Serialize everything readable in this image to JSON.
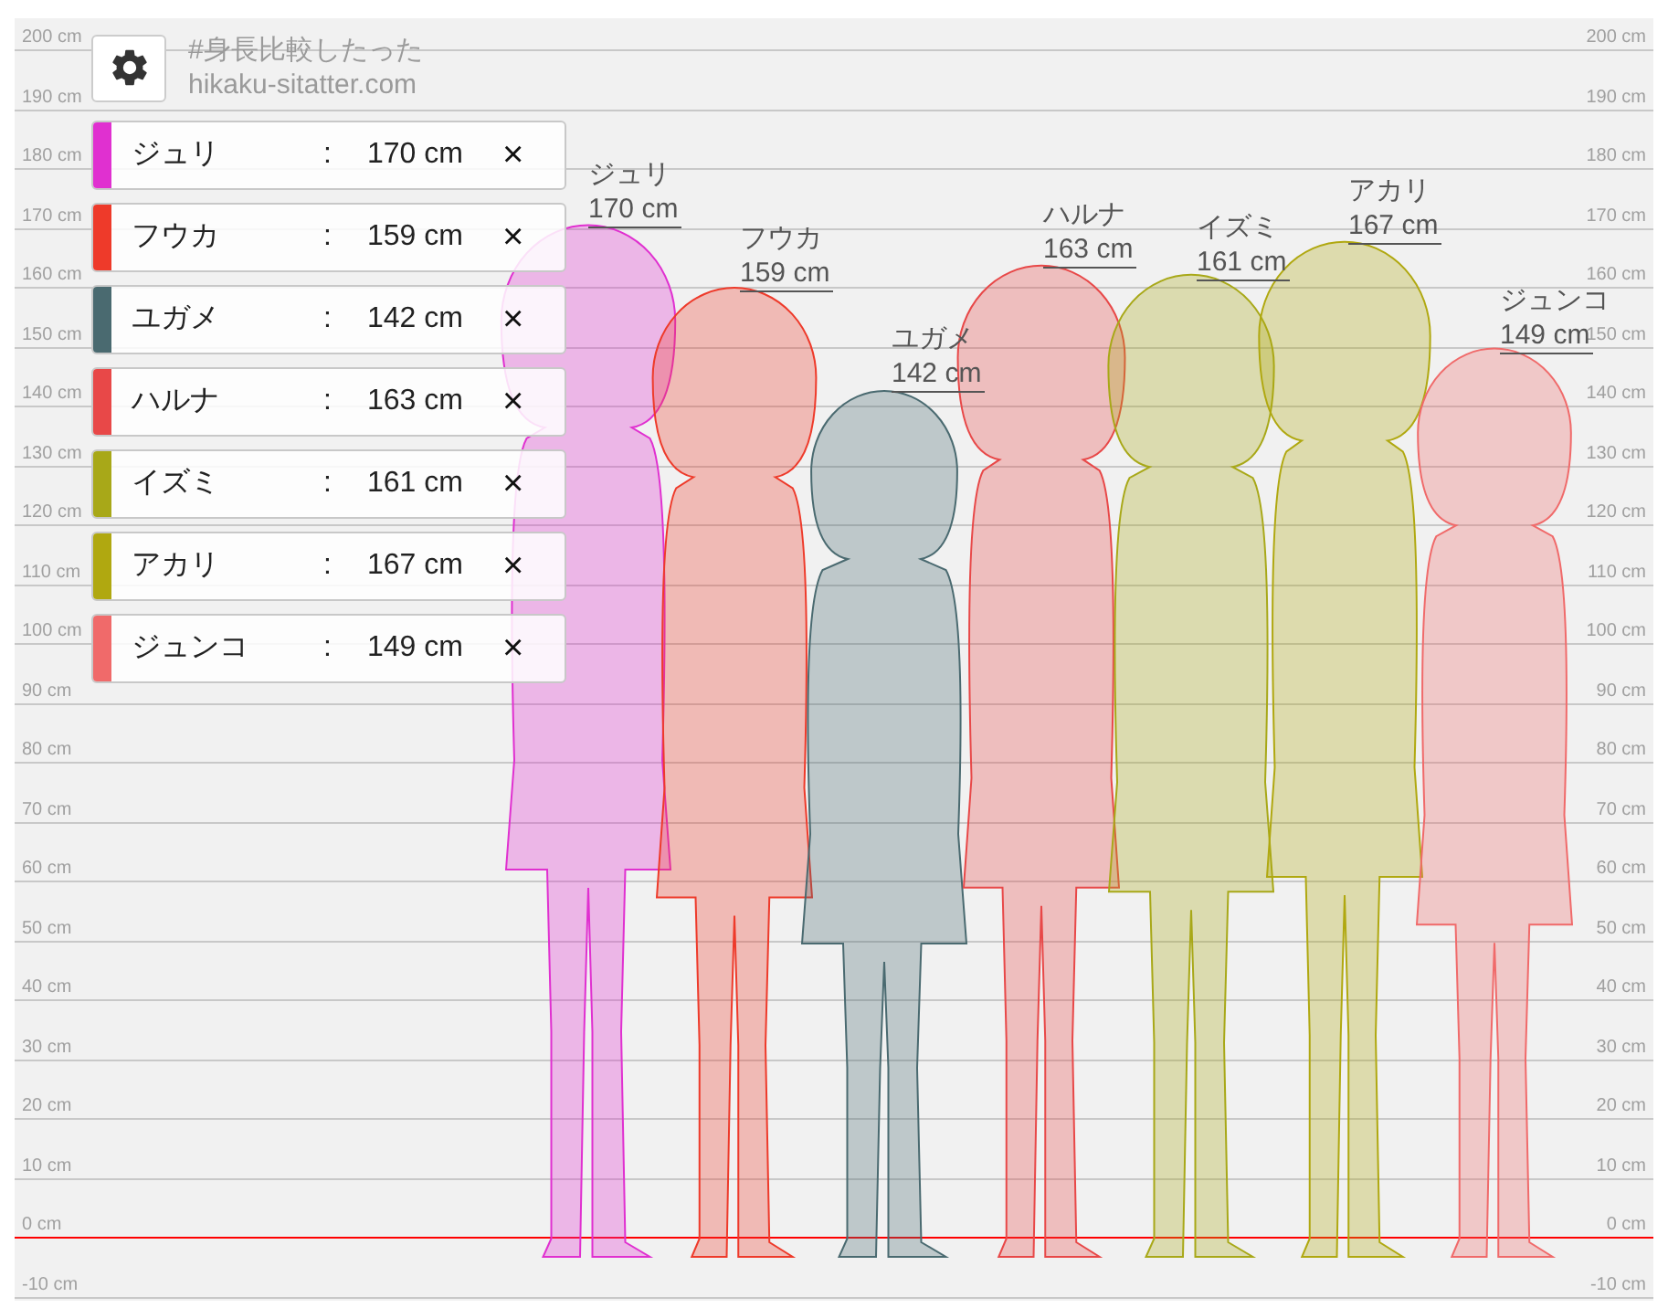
{
  "site": {
    "hashtag": "#身長比較したった",
    "url": "hikaku-sitatter.com"
  },
  "people": [
    {
      "name": "ジュリ",
      "separator": ":",
      "height": "170 cm",
      "remove": "×",
      "color": "#e030d0"
    },
    {
      "name": "フウカ",
      "separator": ":",
      "height": "159 cm",
      "remove": "×",
      "color": "#ee3a2a"
    },
    {
      "name": "ユガメ",
      "separator": ":",
      "height": "142 cm",
      "remove": "×",
      "color": "#4a6a70"
    },
    {
      "name": "ハルナ",
      "separator": ":",
      "height": "163 cm",
      "remove": "×",
      "color": "#e84848"
    },
    {
      "name": "イズミ",
      "separator": ":",
      "height": "161 cm",
      "remove": "×",
      "color": "#a8a818"
    },
    {
      "name": "アカリ",
      "separator": ":",
      "height": "167 cm",
      "remove": "×",
      "color": "#b0a810"
    },
    {
      "name": "ジュンコ",
      "separator": ":",
      "height": "149 cm",
      "remove": "×",
      "color": "#f06a6a"
    }
  ],
  "figures": [
    {
      "name": "ジュリ",
      "height": "170 cm",
      "color": "#e030d0"
    },
    {
      "name": "フウカ",
      "height": "159 cm",
      "color": "#ee3a2a"
    },
    {
      "name": "ユガメ",
      "height": "142 cm",
      "color": "#4a6a70"
    },
    {
      "name": "ハルナ",
      "height": "163 cm",
      "color": "#e84848"
    },
    {
      "name": "イズミ",
      "height": "161 cm",
      "color": "#a8a818"
    },
    {
      "name": "アカリ",
      "height": "167 cm",
      "color": "#b0a810"
    },
    {
      "name": "ジュンコ",
      "height": "149 cm",
      "color": "#f06a6a"
    }
  ],
  "axis": {
    "left_ticks": [
      "200 cm",
      "190 cm",
      "180 cm",
      "170 cm",
      "160 cm",
      "150 cm",
      "140 cm",
      "130 cm",
      "120 cm",
      "110 cm",
      "100 cm",
      "90 cm",
      "80 cm",
      "70 cm",
      "60 cm",
      "50 cm",
      "40 cm",
      "30 cm",
      "20 cm",
      "10 cm",
      "0 cm",
      "-10 cm"
    ],
    "right_ticks": [
      "200 cm",
      "190 cm",
      "180 cm",
      "170 cm",
      "160 cm",
      "150 cm",
      "140 cm",
      "130 cm",
      "120 cm",
      "110 cm",
      "100 cm",
      "90 cm",
      "80 cm",
      "70 cm",
      "60 cm",
      "50 cm",
      "40 cm",
      "30 cm",
      "20 cm",
      "10 cm",
      "0 cm",
      "-10 cm"
    ]
  }
}
